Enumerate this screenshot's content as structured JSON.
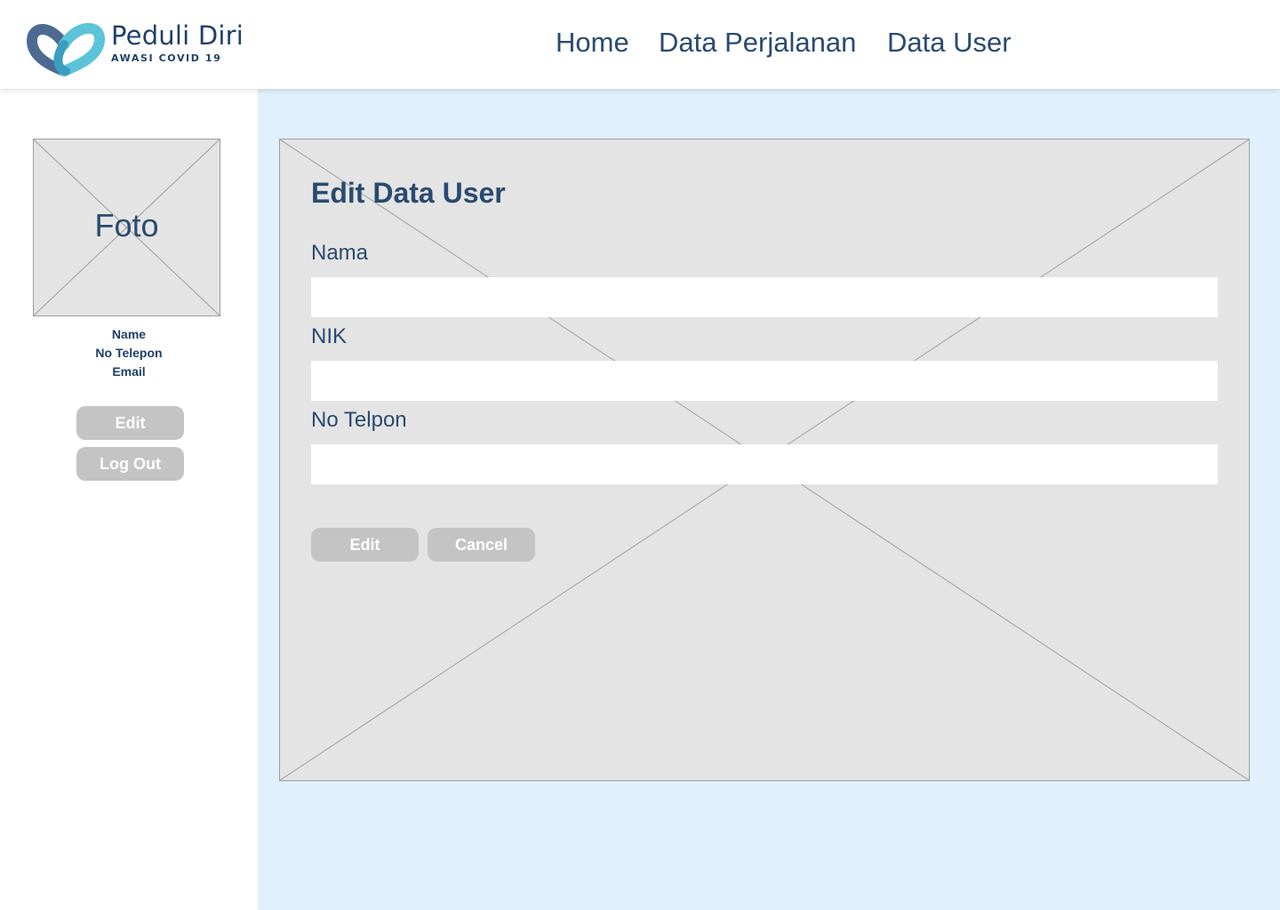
{
  "brand": {
    "name": "Peduli Diri",
    "tagline": "AWASI COVID 19",
    "colors": {
      "primary": "#1f3f6b",
      "accent_light": "#5bc4d8",
      "accent_mid": "#3a9ec0"
    }
  },
  "nav": {
    "items": [
      {
        "label": "Home"
      },
      {
        "label": "Data Perjalanan"
      },
      {
        "label": "Data User"
      }
    ]
  },
  "sidebar": {
    "photo_label": "Foto",
    "info": {
      "name": "Name",
      "phone": "No Telepon",
      "email": "Email"
    },
    "edit_label": "Edit",
    "logout_label": "Log Out"
  },
  "form": {
    "title": "Edit Data User",
    "fields": [
      {
        "label": "Nama",
        "value": ""
      },
      {
        "label": "NIK",
        "value": ""
      },
      {
        "label": "No Telpon",
        "value": ""
      }
    ],
    "submit_label": "Edit",
    "cancel_label": "Cancel"
  },
  "colors": {
    "text": "#294a70",
    "content_bg": "#e0f0fc",
    "placeholder_bg": "#e4e4e4",
    "button_bg": "#c4c4c4"
  }
}
